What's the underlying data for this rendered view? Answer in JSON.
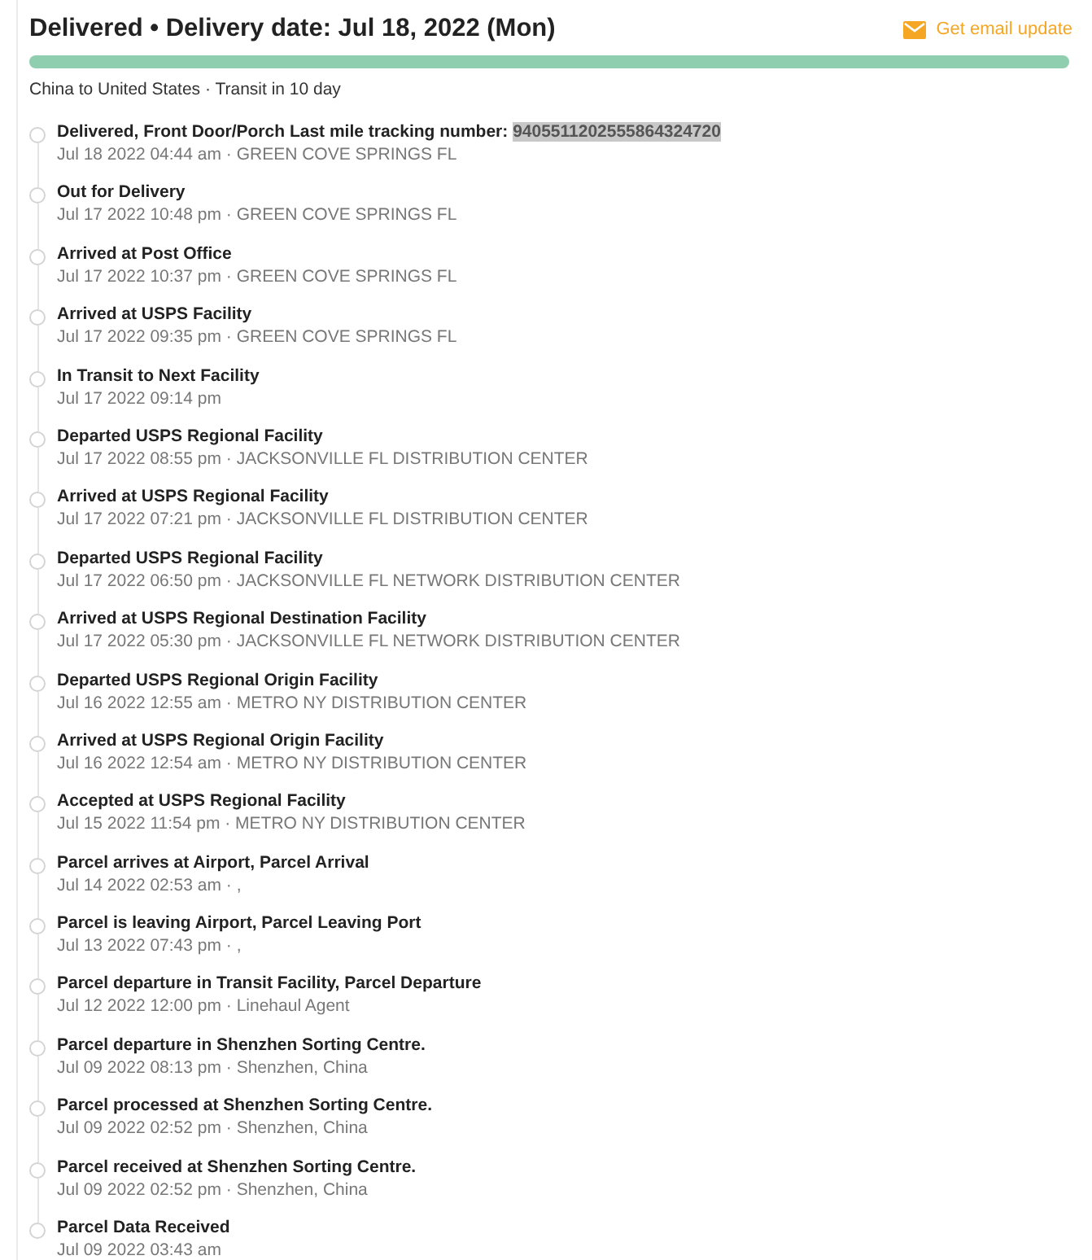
{
  "header": {
    "title": "Delivered • Delivery date: Jul 18, 2022 (Mon)",
    "email_link": "Get email update"
  },
  "progress": {
    "level": 1
  },
  "route": "China to United States · Transit in 10 day",
  "events": [
    {
      "title": "Delivered, Front Door/Porch Last mile tracking number: ",
      "tracking_number": "9405511202555864324720",
      "detail": "Jul 18 2022 04:44 am · GREEN COVE SPRINGS FL"
    },
    {
      "title": "Out for Delivery",
      "detail": "Jul 17 2022 10:48 pm · GREEN COVE SPRINGS FL"
    },
    {
      "title": "Arrived at Post Office",
      "detail": "Jul 17 2022 10:37 pm · GREEN COVE SPRINGS FL"
    },
    {
      "title": "Arrived at USPS Facility",
      "detail": "Jul 17 2022 09:35 pm · GREEN COVE SPRINGS FL"
    },
    {
      "title": "In Transit to Next Facility",
      "detail": "Jul 17 2022 09:14 pm"
    },
    {
      "title": "Departed USPS Regional Facility",
      "detail": "Jul 17 2022 08:55 pm · JACKSONVILLE FL DISTRIBUTION CENTER"
    },
    {
      "title": "Arrived at USPS Regional Facility",
      "detail": "Jul 17 2022 07:21 pm · JACKSONVILLE FL DISTRIBUTION CENTER"
    },
    {
      "title": "Departed USPS Regional Facility",
      "detail": "Jul 17 2022 06:50 pm · JACKSONVILLE FL NETWORK DISTRIBUTION CENTER"
    },
    {
      "title": "Arrived at USPS Regional Destination Facility",
      "detail": "Jul 17 2022 05:30 pm · JACKSONVILLE FL NETWORK DISTRIBUTION CENTER"
    },
    {
      "title": "Departed USPS Regional Origin Facility",
      "detail": "Jul 16 2022 12:55 am · METRO NY DISTRIBUTION CENTER"
    },
    {
      "title": "Arrived at USPS Regional Origin Facility",
      "detail": "Jul 16 2022 12:54 am · METRO NY DISTRIBUTION CENTER"
    },
    {
      "title": "Accepted at USPS Regional Facility",
      "detail": "Jul 15 2022 11:54 pm · METRO NY DISTRIBUTION CENTER"
    },
    {
      "title": "Parcel arrives at Airport, Parcel Arrival",
      "detail": "Jul 14 2022 02:53 am · ,"
    },
    {
      "title": "Parcel is leaving Airport, Parcel Leaving Port",
      "detail": "Jul 13 2022 07:43 pm · ,"
    },
    {
      "title": "Parcel departure in Transit Facility, Parcel Departure",
      "detail": "Jul 12 2022 12:00 pm · Linehaul Agent"
    },
    {
      "title": "Parcel departure in Shenzhen Sorting Centre.",
      "detail": "Jul 09 2022 08:13 pm · Shenzhen, China"
    },
    {
      "title": "Parcel processed at Shenzhen Sorting Centre.",
      "detail": "Jul 09 2022 02:52 pm · Shenzhen, China"
    },
    {
      "title": "Parcel received at Shenzhen Sorting Centre.",
      "detail": "Jul 09 2022 02:52 pm · Shenzhen, China"
    },
    {
      "title": "Parcel Data Received",
      "detail": "Jul 09 2022 03:43 am"
    }
  ]
}
